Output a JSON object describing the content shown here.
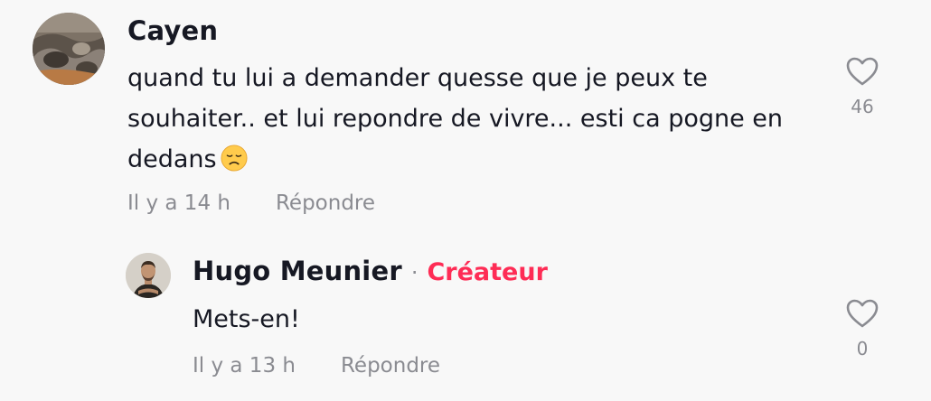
{
  "comment": {
    "username": "Cayen",
    "text": "quand tu lui a demander quesse que je peux te souhaiter.. et lui repondre de vivre... esti ca pogne en dedans",
    "emoji_icon": "disappointed-face-icon",
    "time": "Il y a 14 h",
    "reply_label": "Répondre",
    "like_count": "46",
    "like_icon": "heart-outline-icon"
  },
  "reply": {
    "username": "Hugo Meunier",
    "separator": "·",
    "badge": "Créateur",
    "text": "Mets-en!",
    "time": "Il y a 13 h",
    "reply_label": "Répondre",
    "like_count": "0",
    "like_icon": "heart-outline-icon"
  },
  "colors": {
    "background": "#f8f8f8",
    "text": "#161823",
    "muted": "#8a8b91",
    "creator_accent": "#fe2c55"
  }
}
